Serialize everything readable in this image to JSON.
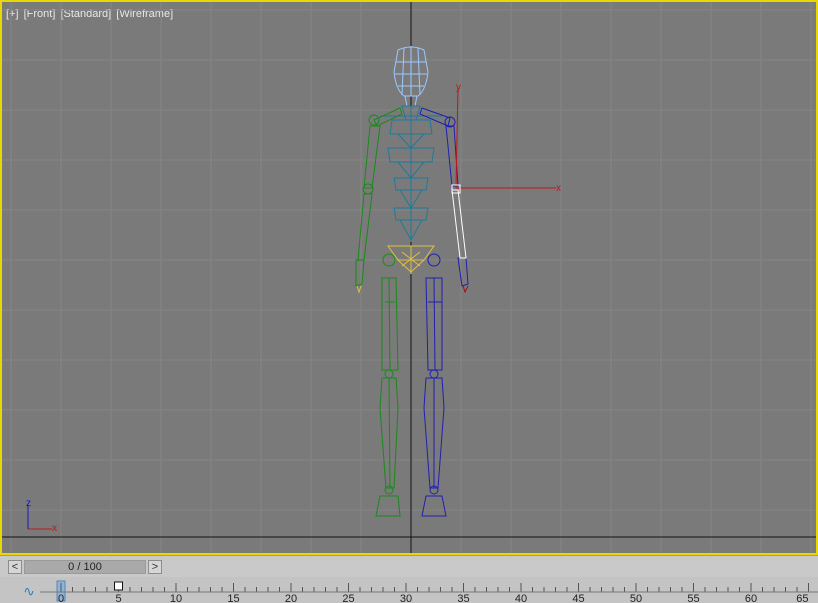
{
  "viewport": {
    "labels": [
      "[+]",
      "[Front]",
      "[Standard]",
      "[Wireframe]"
    ],
    "gizmo_axes": {
      "x": "x",
      "y": "y"
    },
    "corner_axes": {
      "x": "x",
      "z": "z"
    }
  },
  "time_slider": {
    "prev_label": "<",
    "next_label": ">",
    "frame_text": "0 / 100"
  },
  "trackbar": {
    "tick_labels": [
      "0",
      "5",
      "10",
      "15",
      "20",
      "25",
      "30",
      "35",
      "40",
      "45",
      "50",
      "55",
      "60",
      "65"
    ],
    "curve_icon": "function-curve-icon"
  },
  "colors": {
    "viewport_bg": "#7a7a7a",
    "active_border": "#e8d800",
    "left_limbs": "#1a8a1a",
    "right_limbs": "#2020b0",
    "spine": "#1f7a9a",
    "head": "#9cc8ff",
    "pelvis": "#e0c040",
    "selected": "#ffffff"
  }
}
